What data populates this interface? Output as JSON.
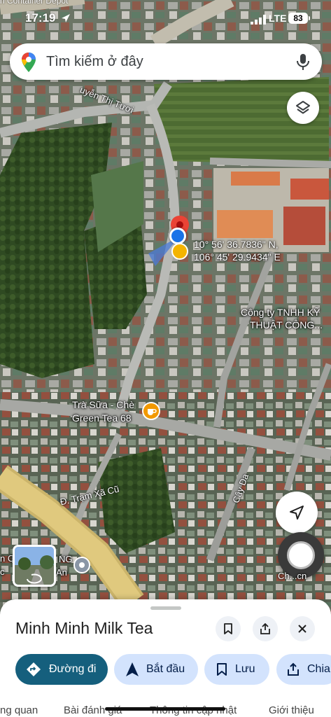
{
  "status": {
    "time": "17:19",
    "top_text": "n Container Depot",
    "network": "LTE",
    "battery": "83"
  },
  "search": {
    "placeholder": "Tìm kiếm ở đây"
  },
  "map": {
    "labels": {
      "street_nguyen": "uyễn Thị Tươi",
      "company": "Công ty TNHH KỸ",
      "company2": "THUẬT CÔNG...",
      "tea_shop1": "Trà Sữa - Chè",
      "tea_shop2": "Green Tea 68",
      "tram_xa_cu": "Đ. Trạm Xã Cũ",
      "cay_da": "Cây Da",
      "left_text1": "n Ơ",
      "left_text2": "c",
      "left_text3": "NG",
      "left_text4": "An",
      "chi_text": "Ch...cn"
    },
    "coords": {
      "lat": "10° 56' 36.7836\" N,",
      "lng": "106° 45' 29.9434\" E"
    },
    "colors": {
      "pin": "#ea4335",
      "dot": "#1a73e8",
      "cafe": "#f29900"
    }
  },
  "sheet": {
    "title": "Minh Minh Milk Tea",
    "actions": {
      "directions": "Đường đi",
      "start": "Bắt đầu",
      "save": "Lưu",
      "share": "Chia"
    },
    "tabs": [
      "ng quan",
      "Bài đánh giá",
      "Thông tin cập nhật",
      "Giới thiệu"
    ]
  }
}
